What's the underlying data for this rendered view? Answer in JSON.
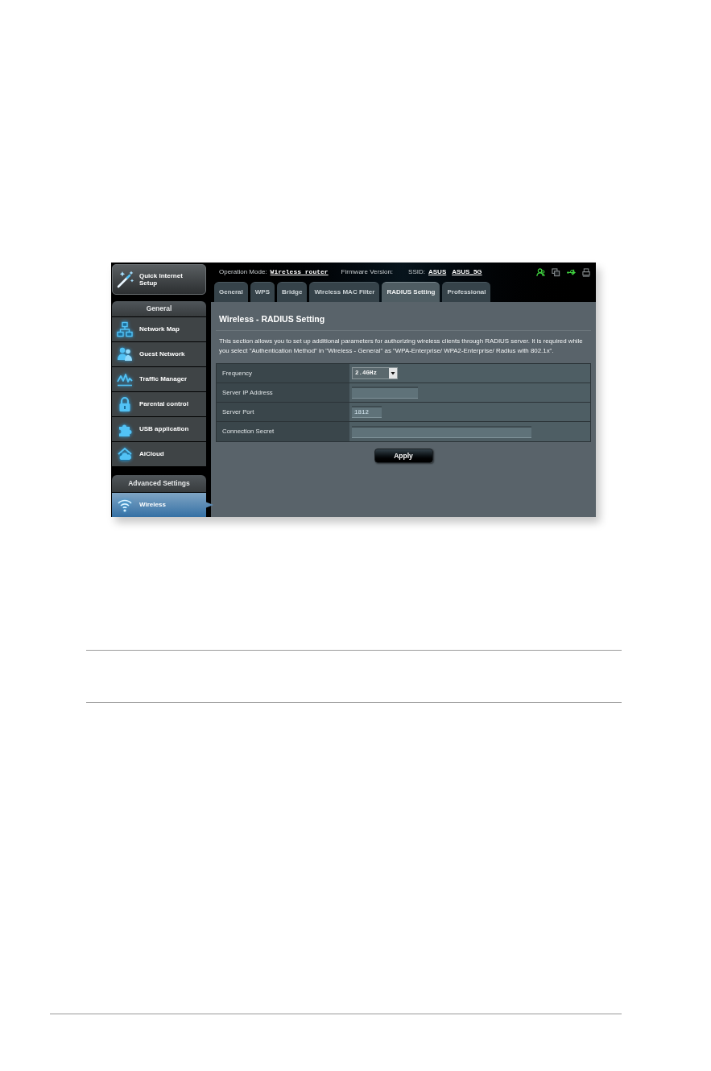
{
  "sidebar": {
    "quick_setup": "Quick Internet Setup",
    "sections": [
      {
        "title": "General",
        "items": [
          {
            "label": "Network Map",
            "selected": false
          },
          {
            "label": "Guest Network",
            "selected": false
          },
          {
            "label": "Traffic Manager",
            "selected": false
          },
          {
            "label": "Parental control",
            "selected": false
          },
          {
            "label": "USB application",
            "selected": false
          },
          {
            "label": "AiCloud",
            "selected": false
          }
        ]
      },
      {
        "title": "Advanced Settings",
        "items": [
          {
            "label": "Wireless",
            "selected": true
          }
        ]
      }
    ]
  },
  "top_bar": {
    "operation_mode_label": "Operation Mode:",
    "operation_mode": "Wireless router",
    "firmware_label": "Firmware Version:",
    "ssid_label": "SSID:",
    "ssids": [
      "ASUS",
      "ASUS_5G"
    ],
    "status_icons": [
      {
        "kind": "clients",
        "on": true
      },
      {
        "kind": "windows",
        "on": false
      },
      {
        "kind": "usb",
        "on": true
      },
      {
        "kind": "printer",
        "on": false
      }
    ]
  },
  "tabs": [
    {
      "label": "General",
      "selected": false
    },
    {
      "label": "WPS",
      "selected": false
    },
    {
      "label": "Bridge",
      "selected": false
    },
    {
      "label": "Wireless MAC Filter",
      "selected": false
    },
    {
      "label": "RADIUS Setting",
      "selected": true
    },
    {
      "label": "Professional",
      "selected": false
    }
  ],
  "content": {
    "title": "Wireless - RADIUS Setting",
    "description": "This section allows you to set up additional parameters for authorizing wireless clients through RADIUS server. It is required while you select \"Authentication Method\" in \"Wireless - General\" as \"WPA-Enterprise/ WPA2-Enterprise/ Radius with 802.1x\".",
    "fields": [
      {
        "label": "Frequency",
        "kind": "select",
        "value": "2.4GHz"
      },
      {
        "label": "Server IP Address",
        "kind": "text"
      },
      {
        "label": "Server Port",
        "kind": "text",
        "value": "1812"
      },
      {
        "label": "Connection Secret",
        "kind": "text"
      }
    ],
    "apply_button": "Apply"
  }
}
